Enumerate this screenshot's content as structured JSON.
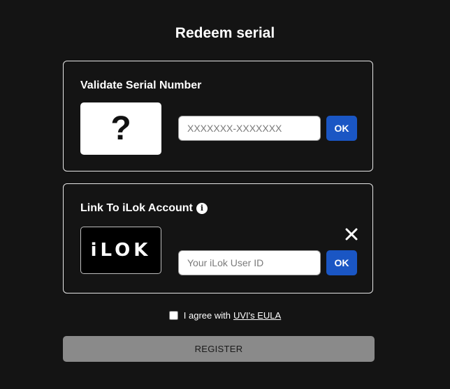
{
  "page": {
    "title": "Redeem serial"
  },
  "serial_panel": {
    "title": "Validate Serial Number",
    "image_glyph": "?",
    "input_placeholder": "XXXXXXX-XXXXXXX",
    "input_value": "",
    "ok_label": "OK"
  },
  "ilok_panel": {
    "title": "Link To iLok Account",
    "info_icon": "info-icon",
    "logo_text": "iLOK",
    "input_placeholder": "Your iLok User ID",
    "input_value": "",
    "ok_label": "OK",
    "close_icon": "close-icon"
  },
  "eula": {
    "checked": false,
    "prefix": "I agree with",
    "link_text": "UVI's EULA"
  },
  "register": {
    "label": "REGISTER"
  },
  "colors": {
    "background": "#141414",
    "accent": "#1a56c4",
    "register_bg": "#8a8a8a"
  }
}
